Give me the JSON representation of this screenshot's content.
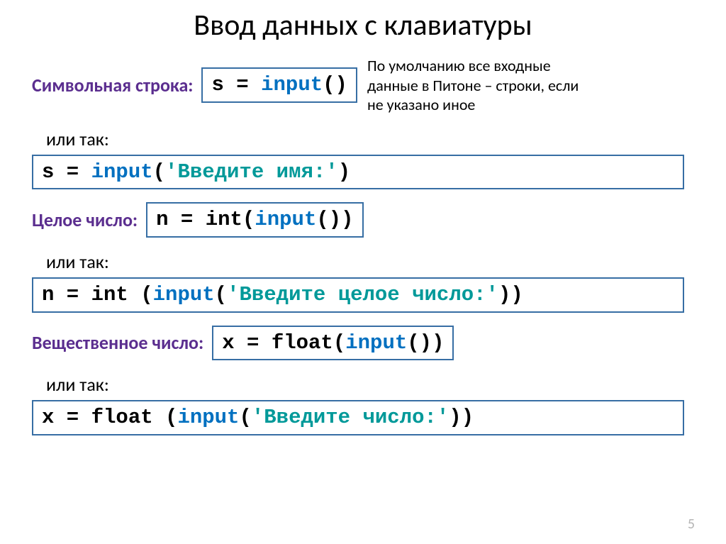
{
  "title": "Ввод данных с клавиатуры",
  "sideNote": "По умолчанию все входные данные в Питоне – строки, если не указано иное",
  "pageNumber": "5",
  "labels": {
    "stringLabel": "Символьная строка:",
    "or1": "или так:",
    "intLabel": "Целое число:",
    "or2": "или так:",
    "floatLabel": "Вещественное число:",
    "or3": "или так:"
  },
  "code": {
    "box1": {
      "p1": "s = ",
      "p2": "input",
      "p3": "()"
    },
    "box2": {
      "p1": "s = ",
      "p2": "input",
      "p3": "(",
      "p4": "'Введите имя:'",
      "p5": ")"
    },
    "box3": {
      "p1": "n = int",
      "p2": "(",
      "p3": "input",
      "p4": "())"
    },
    "box4": {
      "p1": "n = int ",
      "p2": "(",
      "p3": "input",
      "p4": "(",
      "p5": "'Введите целое число:'",
      "p6": "))"
    },
    "box5": {
      "p1": "x = float",
      "p2": "(",
      "p3": "input",
      "p4": "())"
    },
    "box6": {
      "p1": "x = float ",
      "p2": "(",
      "p3": "input",
      "p4": "(",
      "p5": "'Введите число:'",
      "p6": "))"
    }
  }
}
